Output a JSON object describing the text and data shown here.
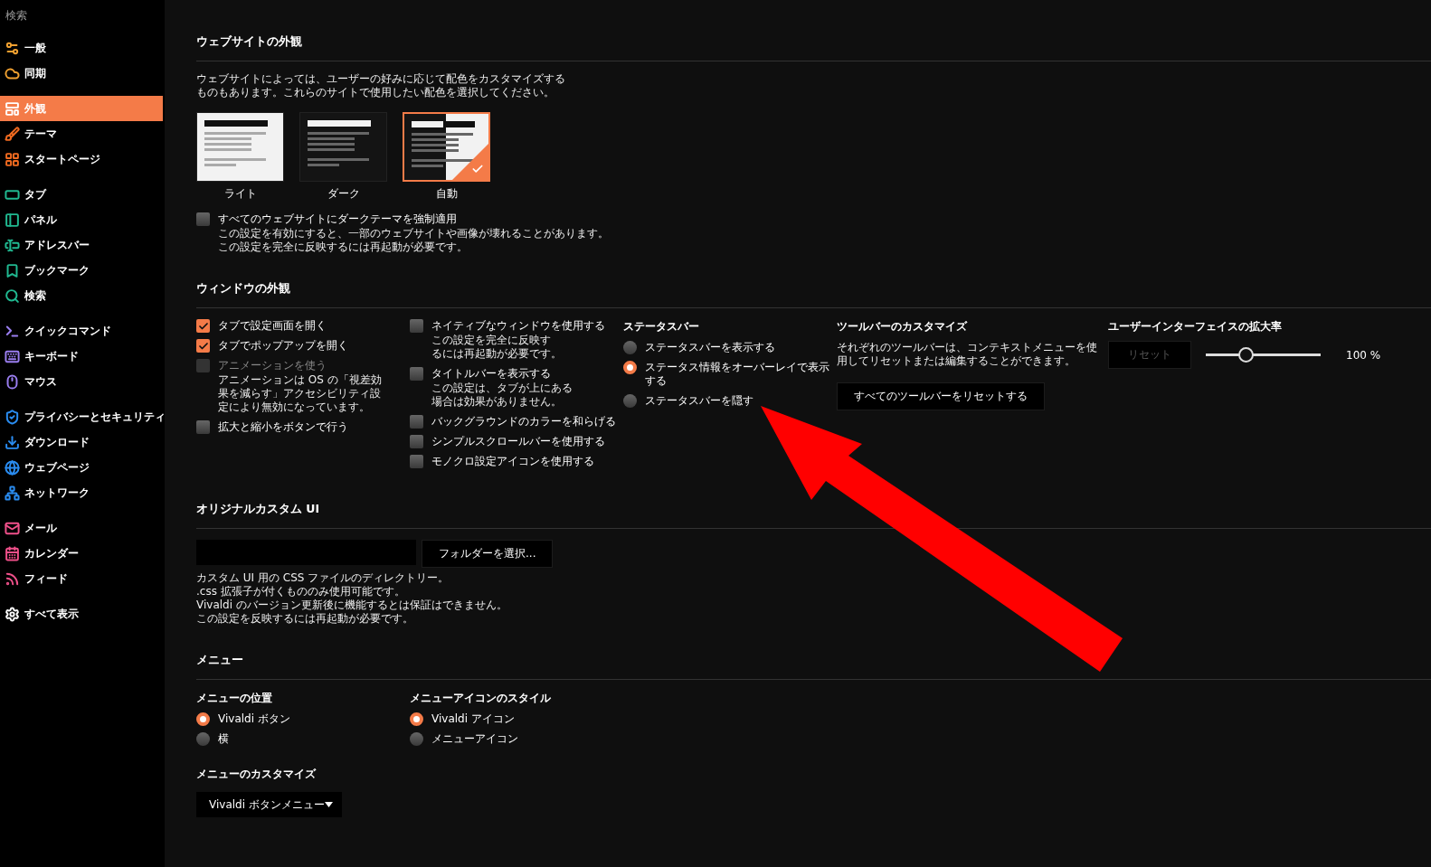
{
  "sidebar": {
    "search_placeholder": "検索",
    "groups": [
      {
        "items": [
          {
            "label": "一般",
            "selected": false,
            "color": "#f0a030"
          },
          {
            "label": "同期",
            "selected": false,
            "color": "#f0a030"
          }
        ]
      },
      {
        "items": [
          {
            "label": "外観",
            "selected": true,
            "color": "#ffffff"
          },
          {
            "label": "テーマ",
            "selected": false,
            "color": "#f06a20"
          },
          {
            "label": "スタートページ",
            "selected": false,
            "color": "#f06a20"
          }
        ]
      },
      {
        "items": [
          {
            "label": "タブ",
            "selected": false,
            "color": "#20b890"
          },
          {
            "label": "パネル",
            "selected": false,
            "color": "#20b890"
          },
          {
            "label": "アドレスバー",
            "selected": false,
            "color": "#20b890"
          },
          {
            "label": "ブックマーク",
            "selected": false,
            "color": "#20b890"
          },
          {
            "label": "検索",
            "selected": false,
            "color": "#20b890"
          }
        ]
      },
      {
        "items": [
          {
            "label": "クイックコマンド",
            "selected": false,
            "color": "#9a7ef0"
          },
          {
            "label": "キーボード",
            "selected": false,
            "color": "#9a7ef0"
          },
          {
            "label": "マウス",
            "selected": false,
            "color": "#9a7ef0"
          }
        ]
      },
      {
        "items": [
          {
            "label": "プライバシーとセキュリティ",
            "selected": false,
            "color": "#2a8cf0"
          },
          {
            "label": "ダウンロード",
            "selected": false,
            "color": "#2a8cf0"
          },
          {
            "label": "ウェブページ",
            "selected": false,
            "color": "#2a8cf0"
          },
          {
            "label": "ネットワーク",
            "selected": false,
            "color": "#2a8cf0"
          }
        ]
      },
      {
        "items": [
          {
            "label": "メール",
            "selected": false,
            "color": "#f0508a"
          },
          {
            "label": "カレンダー",
            "selected": false,
            "color": "#f0508a"
          },
          {
            "label": "フィード",
            "selected": false,
            "color": "#f0508a"
          }
        ]
      },
      {
        "items": [
          {
            "label": "すべて表示",
            "selected": false,
            "color": "#ffffff"
          }
        ]
      }
    ]
  },
  "website_appearance": {
    "title": "ウェブサイトの外観",
    "description": [
      "ウェブサイトによっては、ユーザーの好みに応じて配色をカスタマイズする",
      "ものもあります。これらのサイトで使用したい配色を選択してください。"
    ],
    "themes": [
      {
        "kind": "light",
        "label": "ライト",
        "selected": false
      },
      {
        "kind": "dark",
        "label": "ダーク",
        "selected": false
      },
      {
        "kind": "auto",
        "label": "自動",
        "selected": true
      }
    ],
    "force_dark": {
      "label": "すべてのウェブサイトにダークテーマを強制適用",
      "checked": false,
      "disabled": false,
      "note": [
        "この設定を有効にすると、一部のウェブサイトや画像が壊れることがあります。",
        "この設定を完全に反映するには再起動が必要です。"
      ]
    }
  },
  "window_appearance": {
    "title": "ウィンドウの外観",
    "column_1": [
      {
        "label": "タブで設定画面を開く",
        "checked": true,
        "disabled": false
      },
      {
        "label": "タブでポップアップを開く",
        "checked": true,
        "disabled": false
      },
      {
        "label": "アニメーションを使う",
        "checked": false,
        "disabled": true,
        "note": [
          "アニメーションは OS の「視差効",
          "果を減らす」アクセシビリティ設",
          "定により無効になっています。"
        ]
      },
      {
        "label": "拡大と縮小をボタンで行う",
        "checked": false,
        "disabled": false
      }
    ],
    "column_2": [
      {
        "label": "ネイティブなウィンドウを使用する",
        "checked": false,
        "disabled": false,
        "note": [
          "この設定を完全に反映す",
          "るには再起動が必要です。"
        ]
      },
      {
        "label": "タイトルバーを表示する",
        "checked": false,
        "disabled": false,
        "note": [
          "この設定は、タブが上にある",
          "場合は効果がありません。"
        ]
      },
      {
        "label": "バックグラウンドのカラーを和らげる",
        "checked": false,
        "disabled": false
      },
      {
        "label": "シンプルスクロールバーを使用する",
        "checked": false,
        "disabled": false
      },
      {
        "label": "モノクロ設定アイコンを使用する",
        "checked": false,
        "disabled": false
      }
    ],
    "status_bar": {
      "title": "ステータスバー",
      "options": [
        {
          "label": "ステータスバーを表示する",
          "selected": false
        },
        {
          "label": "ステータス情報をオーバーレイで表示する",
          "selected": true
        },
        {
          "label": "ステータスバーを隠す",
          "selected": false
        }
      ]
    },
    "toolbar": {
      "title": "ツールバーのカスタマイズ",
      "description": [
        "それぞれのツールバーは、コンテキストメニューを使",
        "用してリセットまたは編集することができます。"
      ],
      "button": "すべてのツールバーをリセットする"
    },
    "ui_zoom": {
      "title": "ユーザーインターフェイスの拡大率",
      "reset": "リセット",
      "level": 0.35,
      "reading": "100 %"
    }
  },
  "custom_ui": {
    "title": "オリジナルカスタム UI",
    "button": "フォルダーを選択...",
    "notes": [
      "カスタム UI 用の CSS ファイルのディレクトリー。",
      ".css 拡張子が付くもののみ使用可能です。",
      "Vivaldi のバージョン更新後に機能するとは保証はできません。",
      "この設定を反映するには再起動が必要です。"
    ]
  },
  "menu": {
    "title": "メニュー",
    "position": {
      "title": "メニューの位置",
      "options": [
        {
          "label": "Vivaldi ボタン",
          "selected": true
        },
        {
          "label": "横",
          "selected": false
        }
      ]
    },
    "icon_style": {
      "title": "メニューアイコンのスタイル",
      "options": [
        {
          "label": "Vivaldi アイコン",
          "selected": true
        },
        {
          "label": "メニューアイコン",
          "selected": false
        }
      ]
    },
    "customize": {
      "title": "メニューのカスタマイズ",
      "value": "Vivaldi ボタンメニュー"
    }
  }
}
